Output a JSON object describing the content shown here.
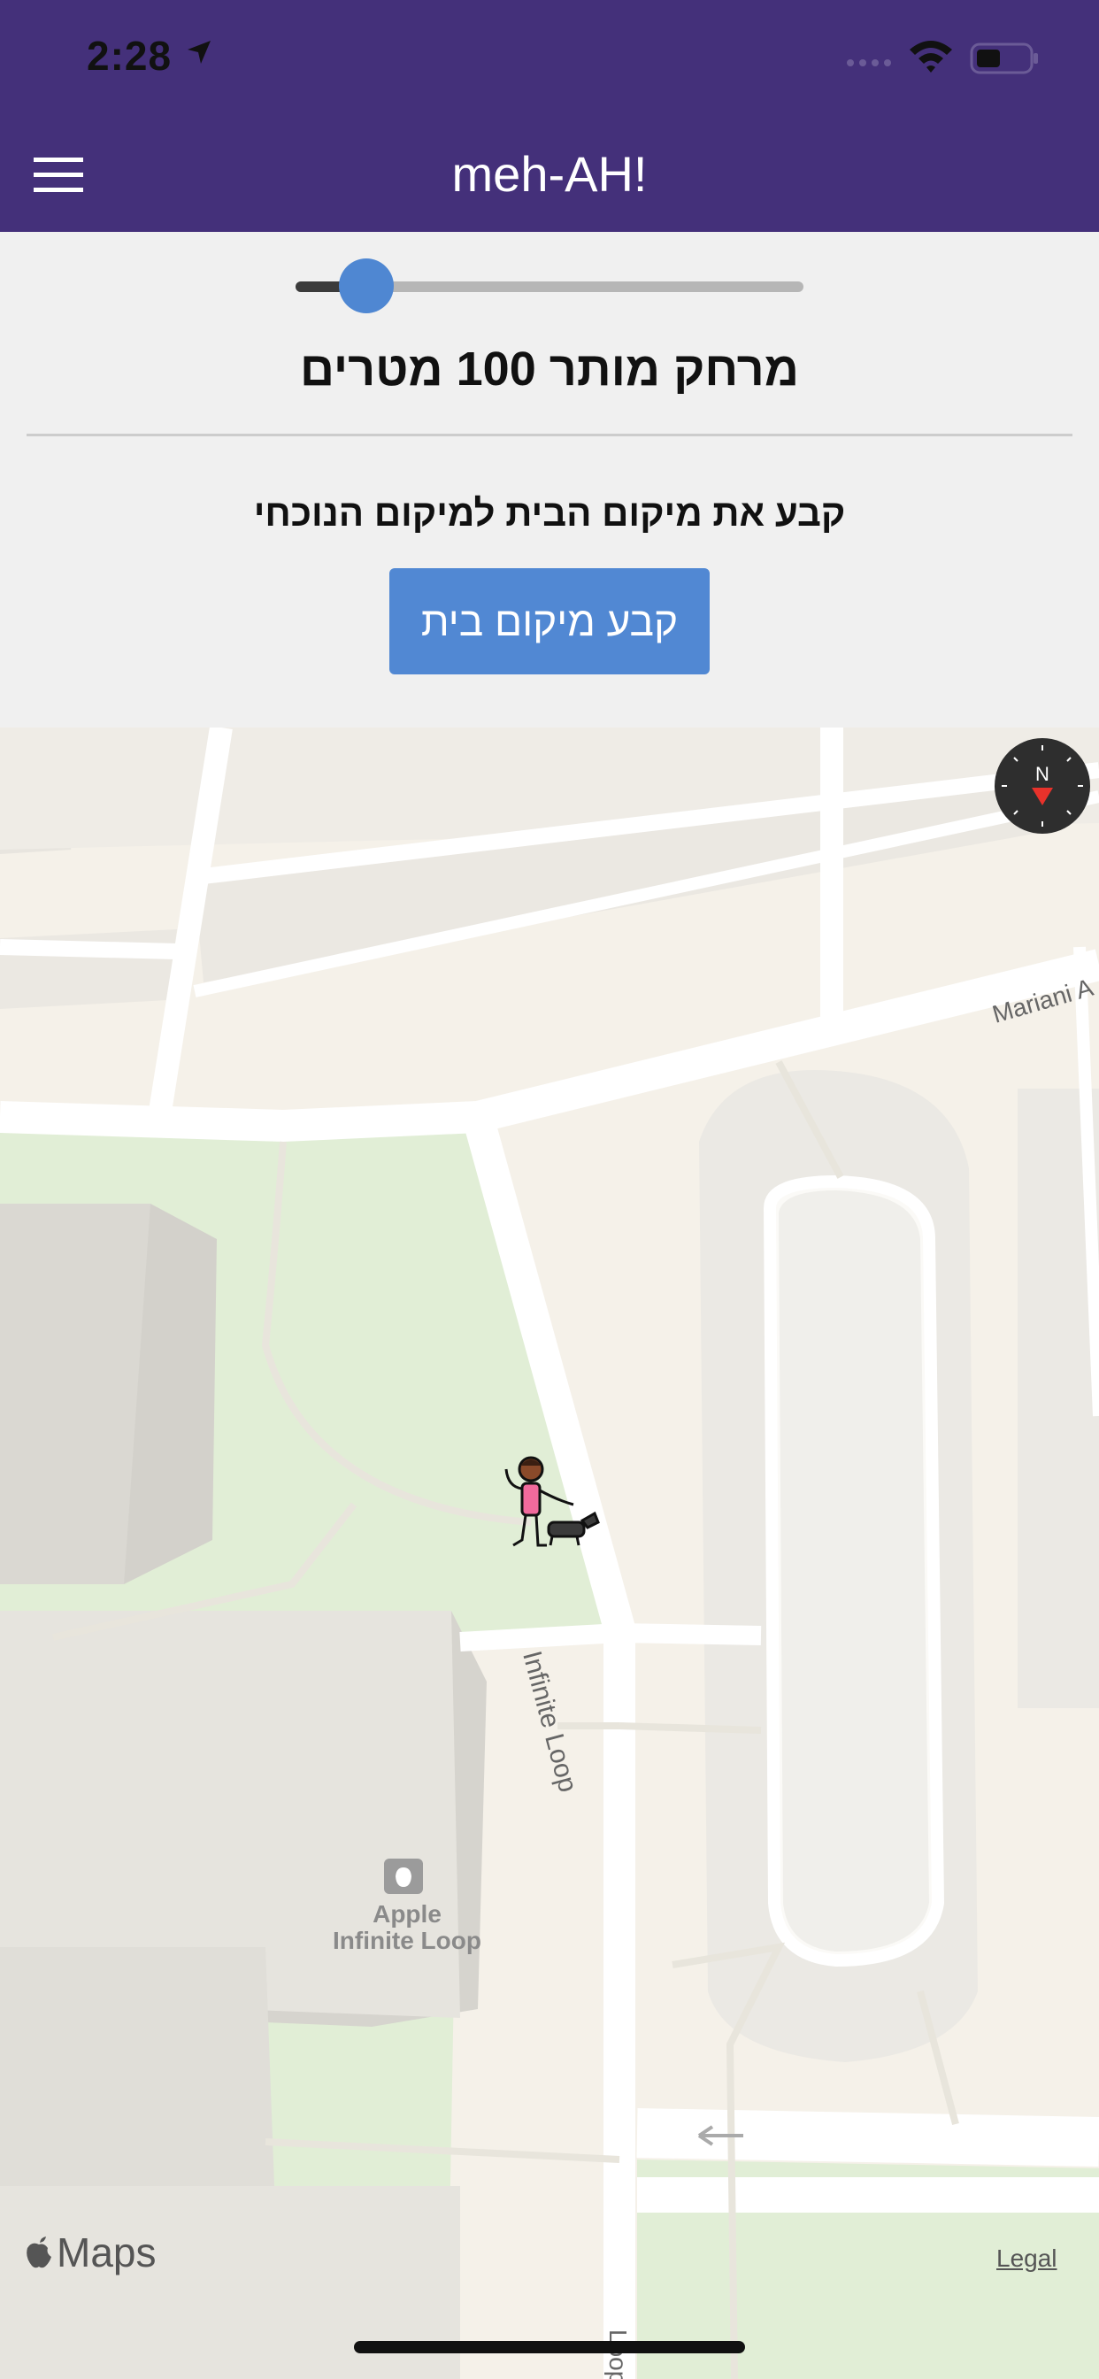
{
  "status_bar": {
    "time": "2:28"
  },
  "header": {
    "title": "meh-AH!",
    "background": "#44307a"
  },
  "distance": {
    "slider_fraction": 0.14,
    "label": "מרחק מותר 100 מטרים"
  },
  "home": {
    "instruction": "קבע את מיקום הבית למיקום הנוכחי",
    "button_label": "קבע מיקום בית",
    "button_color": "#5188d3"
  },
  "map": {
    "street_labels": [
      "Infinite Loop",
      "Mariani A",
      "Loop"
    ],
    "poi_label_line1": "Apple",
    "poi_label_line2": "Infinite Loop",
    "compass_letter": "N",
    "attribution": "Maps",
    "legal": "Legal",
    "user_marker": "walking-person-with-dog-icon"
  }
}
